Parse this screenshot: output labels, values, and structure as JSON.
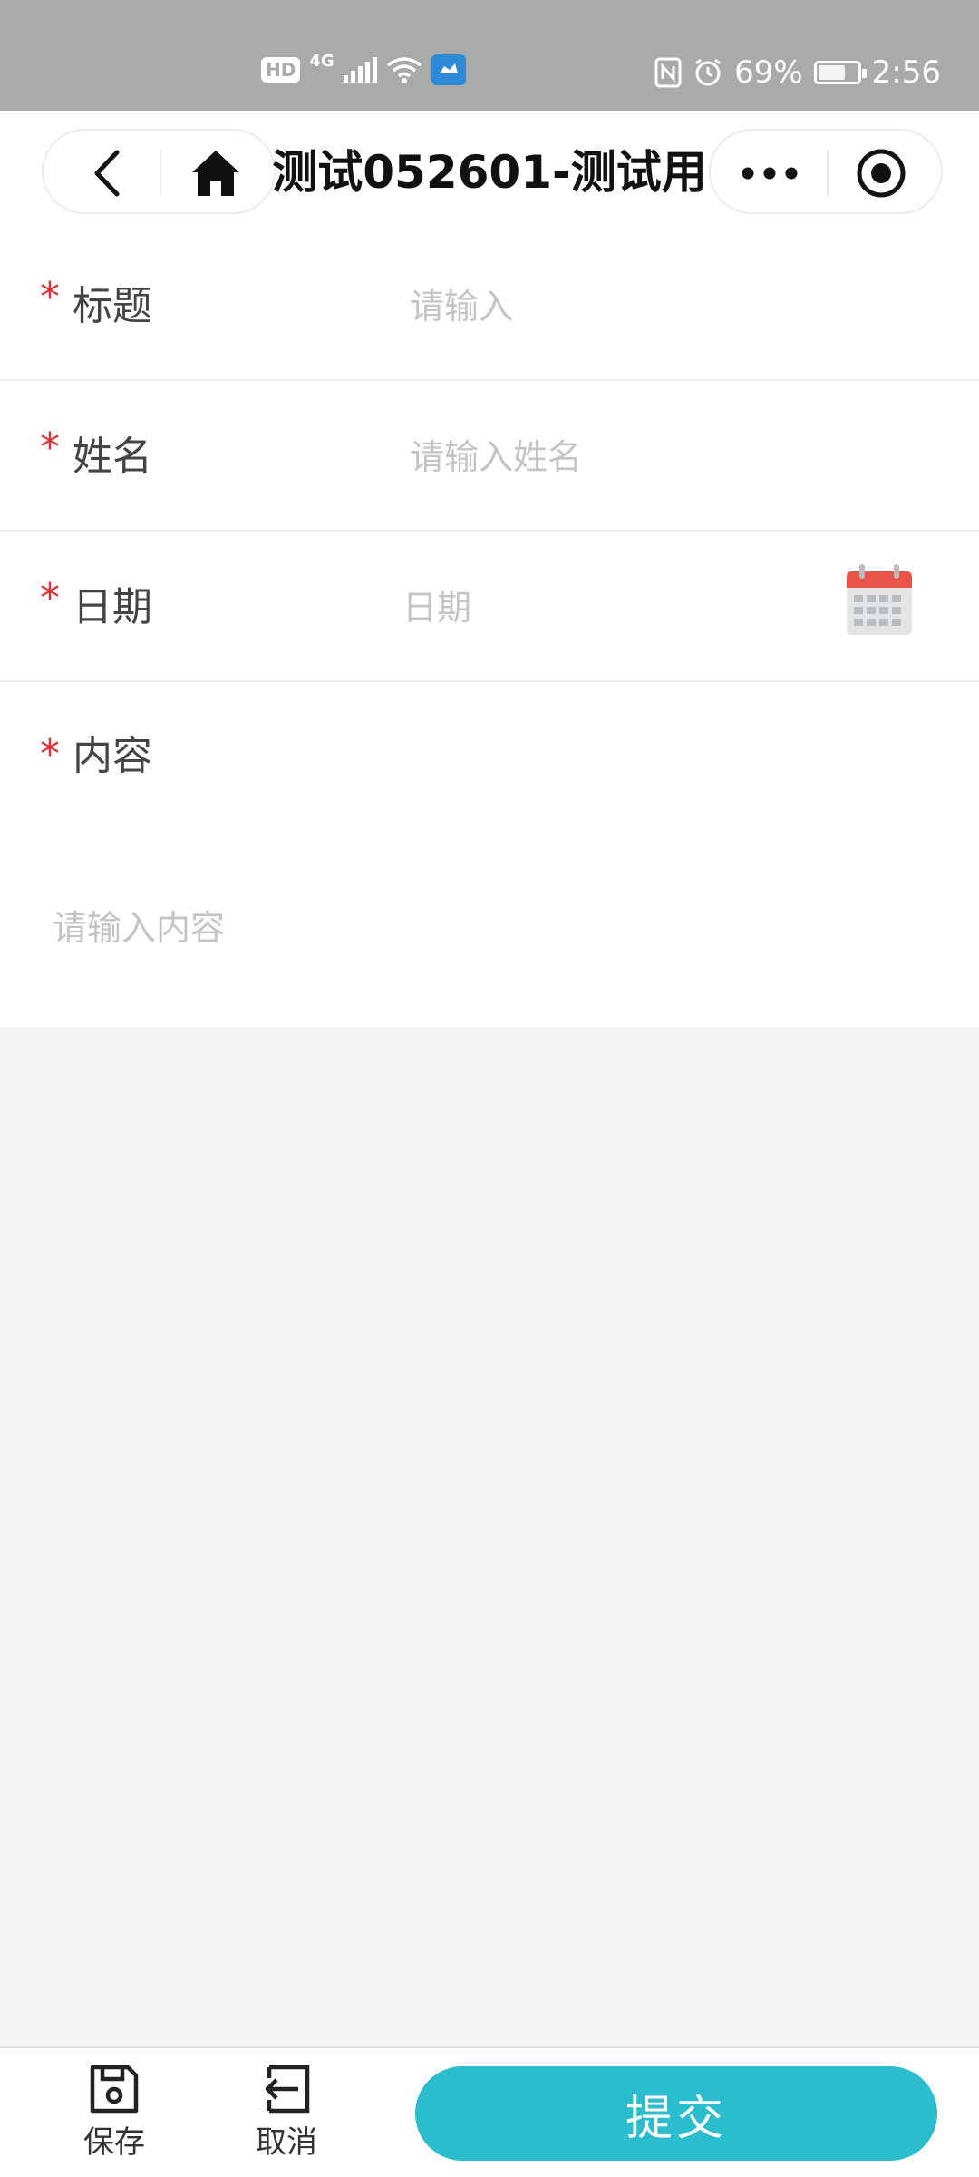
{
  "status_bar": {
    "hd": "HD",
    "network": "4G",
    "battery": "69%",
    "battery_level": 0.69,
    "time": "2:56"
  },
  "nav": {
    "title": "测试052601-测试用"
  },
  "form": {
    "required_mark": "*",
    "title_field": {
      "label": "标题",
      "placeholder": "请输入"
    },
    "name_field": {
      "label": "姓名",
      "placeholder": "请输入姓名"
    },
    "date_field": {
      "label": "日期",
      "placeholder": "日期"
    },
    "content_field": {
      "label": "内容",
      "placeholder": "请输入内容"
    }
  },
  "bottom_bar": {
    "save_label": "保存",
    "cancel_label": "取消",
    "submit_label": "提交"
  },
  "colors": {
    "accent": "#2bbdcd",
    "required": "#e03131",
    "status_bar": "#a9abaa",
    "calendar_red": "#e8544a"
  },
  "icons": {
    "back": "chevron-left-icon",
    "home": "home-icon",
    "more": "more-dots-icon",
    "target": "target-icon",
    "calendar": "calendar-icon",
    "save": "floppy-disk-icon",
    "cancel": "exit-icon"
  }
}
